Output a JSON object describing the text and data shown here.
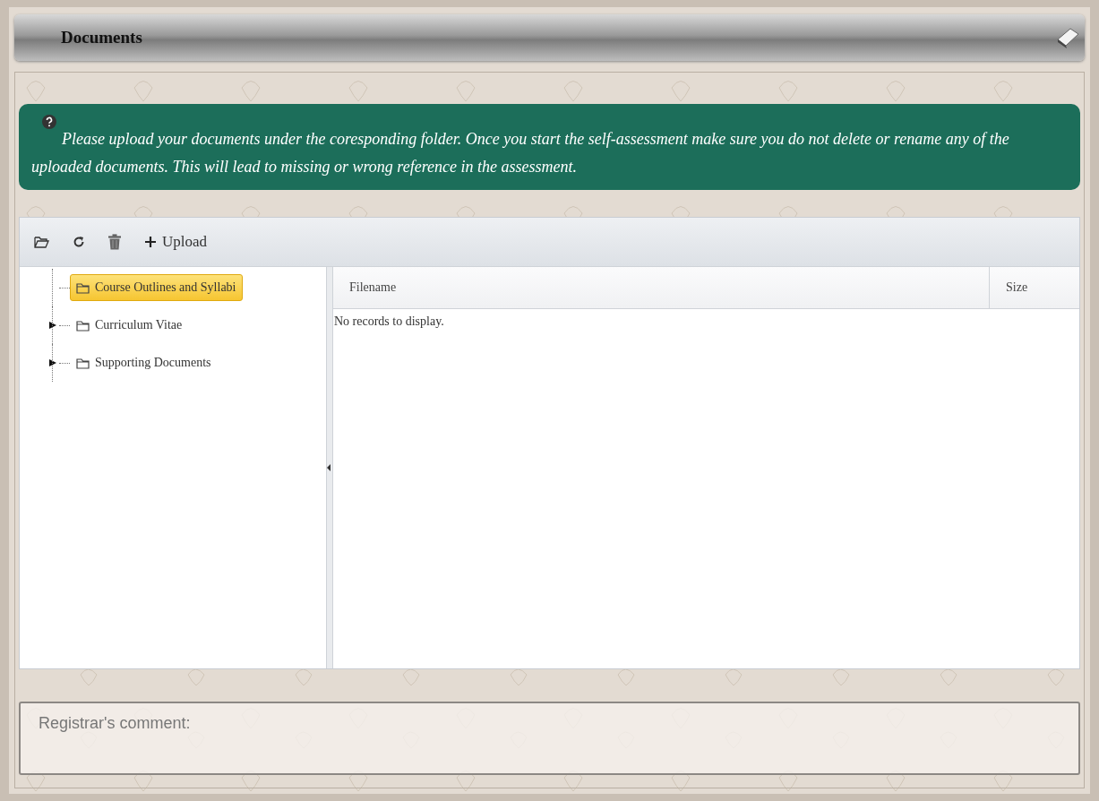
{
  "panel": {
    "title": "Documents"
  },
  "notice": {
    "text": "Please upload your documents under the coresponding folder. Once you start the self-assessment make sure you do not delete or rename any of the uploaded documents. This will lead to missing or wrong reference in the assessment."
  },
  "toolbar": {
    "upload_label": "Upload"
  },
  "tree": [
    {
      "label": "Course Outlines and Syllabi",
      "selected": true,
      "expandable": false
    },
    {
      "label": "Curriculum Vitae",
      "selected": false,
      "expandable": true
    },
    {
      "label": "Supporting Documents",
      "selected": false,
      "expandable": true
    }
  ],
  "grid": {
    "columns": [
      "Filename",
      "Size"
    ],
    "empty_message": "No records to display."
  },
  "comment": {
    "placeholder": "Registrar's comment:"
  }
}
